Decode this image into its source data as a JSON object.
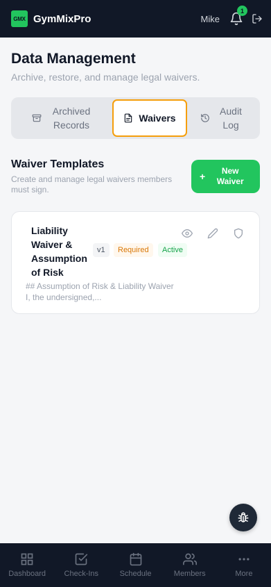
{
  "app": {
    "logo_text": "GMX",
    "name": "GymMixPro"
  },
  "header": {
    "user": "Mike",
    "notification_count": "1"
  },
  "page": {
    "title": "Data Management",
    "subtitle": "Archive, restore, and manage legal waivers."
  },
  "tabs": [
    {
      "label": "Archived Records",
      "icon": "archive-icon",
      "active": false
    },
    {
      "label": "Waivers",
      "icon": "document-icon",
      "active": true
    },
    {
      "label": "Audit Log",
      "icon": "history-icon",
      "active": false
    }
  ],
  "section": {
    "title": "Waiver Templates",
    "description": "Create and manage legal waivers members must sign.",
    "new_button": "New Waiver"
  },
  "waiver": {
    "title": "Liability Waiver & Assumption of Risk",
    "version": "v1",
    "required": "Required",
    "status": "Active",
    "preview": "## Assumption of Risk & Liability Waiver I, the undersigned,..."
  },
  "bottom_nav": [
    {
      "label": "Dashboard",
      "icon": "grid-icon"
    },
    {
      "label": "Check-Ins",
      "icon": "check-square-icon"
    },
    {
      "label": "Schedule",
      "icon": "calendar-icon"
    },
    {
      "label": "Members",
      "icon": "users-icon"
    },
    {
      "label": "More",
      "icon": "more-icon"
    }
  ],
  "colors": {
    "accent": "#22c55e",
    "active_tab_border": "#f59e0b",
    "dark": "#111827"
  }
}
